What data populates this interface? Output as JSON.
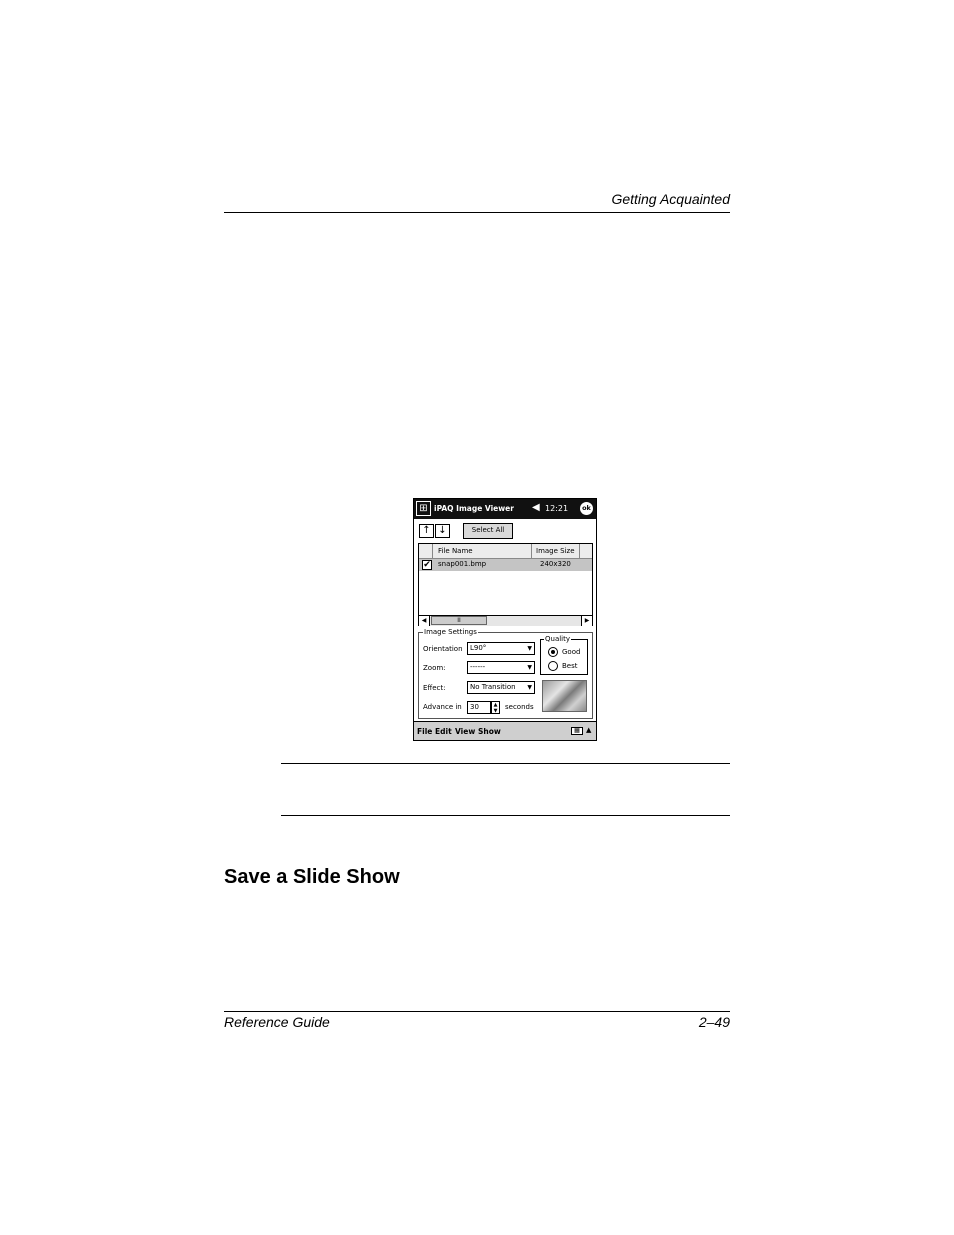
{
  "header": {
    "running_title": "Getting Acquainted"
  },
  "screenshot": {
    "app_title": "iPAQ Image Viewer",
    "clock": "12:21",
    "ok_label": "ok",
    "up_arrow": "↑",
    "down_arrow": "↓",
    "select_all_label": "Select All",
    "columns": {
      "name": "File Name",
      "size": "Image Size"
    },
    "rows": [
      {
        "checked": true,
        "check_glyph": "✔",
        "name": "snap001.bmp",
        "size": "240x320"
      }
    ],
    "scroll_thumb": "II",
    "settings": {
      "group_label": "Image Settings",
      "orientation_label": "Orientation",
      "orientation_value": "L90°",
      "zoom_label": "Zoom:",
      "zoom_value": "------",
      "effect_label": "Effect:",
      "effect_value": "No Transition",
      "advance_label": "Advance in",
      "advance_value": "30",
      "seconds_label": "seconds",
      "quality_label": "Quality",
      "quality_good": "Good",
      "quality_best": "Best",
      "quality_selected": "Good"
    },
    "menu": {
      "file": "File",
      "edit": "Edit",
      "view": "View",
      "show": "Show"
    }
  },
  "section": {
    "heading": "Save a Slide Show"
  },
  "footer": {
    "left": "Reference Guide",
    "right": "2–49"
  }
}
